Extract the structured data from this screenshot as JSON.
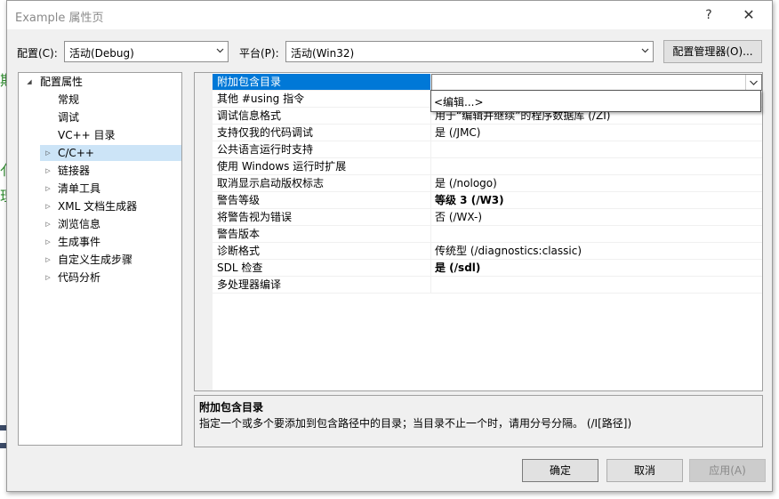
{
  "background": {
    "fragments": [
      "期",
      "亻",
      "理",
      "（",
      "《"
    ]
  },
  "window": {
    "title": "Example 属性页",
    "help_glyph": "?",
    "close_glyph": "✕"
  },
  "toolbar": {
    "config_label": "配置(C):",
    "config_value": "活动(Debug)",
    "platform_label": "平台(P):",
    "platform_value": "活动(Win32)",
    "config_manager_label": "配置管理器(O)..."
  },
  "tree": {
    "items": [
      {
        "label": "配置属性",
        "expander": "◢"
      },
      {
        "label": "常规",
        "expander": ""
      },
      {
        "label": "调试",
        "expander": ""
      },
      {
        "label": "VC++ 目录",
        "expander": ""
      },
      {
        "label": "C/C++",
        "expander": "▷"
      },
      {
        "label": "链接器",
        "expander": "▷"
      },
      {
        "label": "清单工具",
        "expander": "▷"
      },
      {
        "label": "XML 文档生成器",
        "expander": "▷"
      },
      {
        "label": "浏览信息",
        "expander": "▷"
      },
      {
        "label": "生成事件",
        "expander": "▷"
      },
      {
        "label": "自定义生成步骤",
        "expander": "▷"
      },
      {
        "label": "代码分析",
        "expander": "▷"
      }
    ],
    "selected_index": 4
  },
  "properties": {
    "rows": [
      {
        "name": "附加包含目录",
        "value": ""
      },
      {
        "name": "其他 #using 指令",
        "value": ""
      },
      {
        "name": "调试信息格式",
        "value": "用于“编辑并继续”的程序数据库 (/ZI)"
      },
      {
        "name": "支持仅我的代码调试",
        "value": "是 (/JMC)"
      },
      {
        "name": "公共语言运行时支持",
        "value": ""
      },
      {
        "name": "使用 Windows 运行时扩展",
        "value": ""
      },
      {
        "name": "取消显示启动版权标志",
        "value": "是 (/nologo)"
      },
      {
        "name": "警告等级",
        "value": "等级 3 (/W3)"
      },
      {
        "name": "将警告视为错误",
        "value": "否 (/WX-)"
      },
      {
        "name": "警告版本",
        "value": ""
      },
      {
        "name": "诊断格式",
        "value": "传统型 (/diagnostics:classic)"
      },
      {
        "name": "SDL 检查",
        "value": "是 (/sdl)"
      },
      {
        "name": "多处理器编译",
        "value": ""
      }
    ],
    "bold_values": [
      7,
      11
    ],
    "selected_index": 0,
    "dropdown_option": "<编辑...>"
  },
  "description": {
    "title": "附加包含目录",
    "text": "指定一个或多个要添加到包含路径中的目录；当目录不止一个时，请用分号分隔。     (/I[路径])"
  },
  "buttons": {
    "ok": "确定",
    "cancel": "取消",
    "apply": "应用(A)"
  },
  "colors": {
    "selection": "#0078d7",
    "tree_selection": "#cce4f7",
    "dialog_bg": "#f0f0f0"
  }
}
